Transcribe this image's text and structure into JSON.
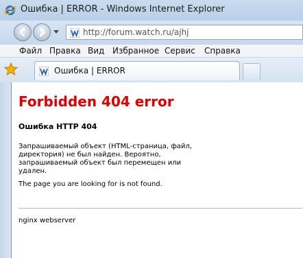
{
  "window": {
    "title": "Ошибка | ERROR - Windows Internet Explorer"
  },
  "address_bar": {
    "url": "http://forum.watch.ru/ajhj"
  },
  "menu": {
    "items": [
      "Файл",
      "Правка",
      "Вид",
      "Избранное",
      "Сервис",
      "Справка"
    ]
  },
  "tab": {
    "label": "Ошибка | ERROR"
  },
  "page": {
    "heading": "Forbidden 404 error",
    "subheading": "Ошибка HTTP 404",
    "message_ru": "Запрашиваемый объект (HTML-страница, файл, директория) не был найден. Вероятно, запрашиваемый объект был перемещен или удален.",
    "message_en": "The page you are looking for is not found.",
    "footer": "nginx webserver"
  },
  "colors": {
    "error_red": "#e00000",
    "favicon_blue": "#2a62b6"
  },
  "icons": {
    "browser": "ie-logo-icon",
    "back": "back-arrow-icon",
    "forward": "forward-arrow-icon",
    "site": "watch-favicon-icon",
    "favorites": "favorites-star-icon"
  }
}
